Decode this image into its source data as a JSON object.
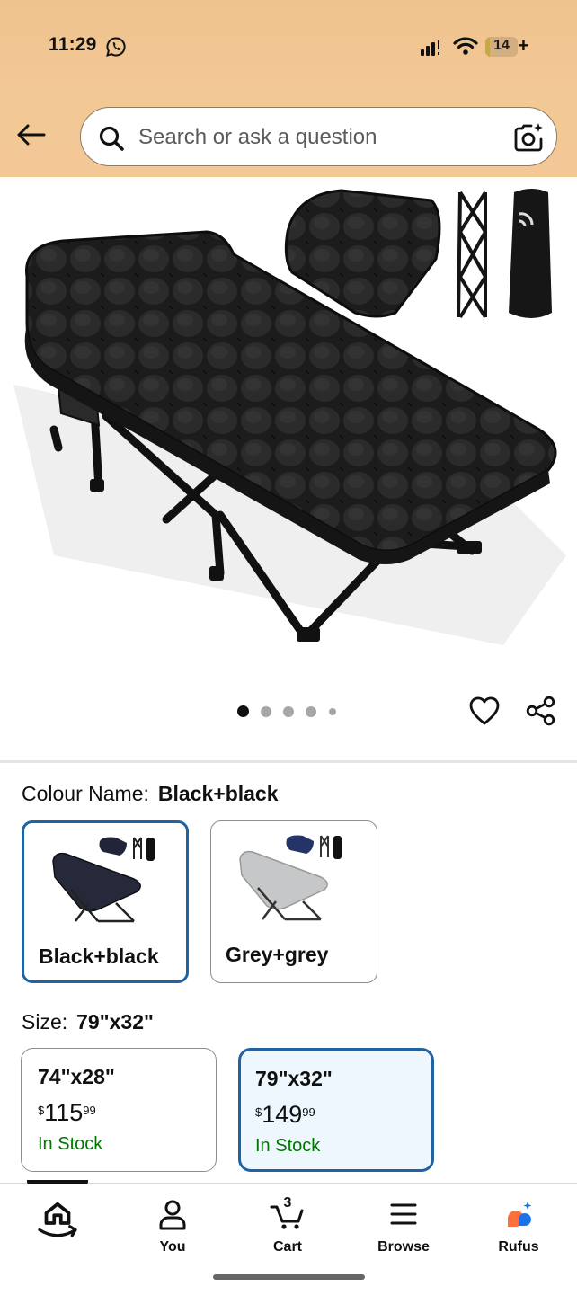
{
  "status_bar": {
    "time": "11:29",
    "battery_level": "14",
    "battery_charging": "+"
  },
  "search": {
    "placeholder": "Search or ask a question"
  },
  "gallery": {
    "image_count": 5,
    "active_index": 0
  },
  "colour": {
    "label": "Colour Name:",
    "selected": "Black+black",
    "options": [
      {
        "name": "Black+black",
        "selected": true
      },
      {
        "name": "Grey+grey",
        "selected": false
      }
    ]
  },
  "size": {
    "label": "Size:",
    "selected": "79\"x32\"",
    "options": [
      {
        "name": "74\"x28\"",
        "currency": "$",
        "price_whole": "115",
        "price_fraction": "99",
        "stock": "In Stock",
        "selected": false
      },
      {
        "name": "79\"x32\"",
        "currency": "$",
        "price_whole": "149",
        "price_fraction": "99",
        "stock": "In Stock",
        "selected": true
      }
    ]
  },
  "bottom_nav": {
    "items": [
      {
        "label": "",
        "icon": "home-icon",
        "active": true
      },
      {
        "label": "You",
        "icon": "user-icon"
      },
      {
        "label": "Cart",
        "icon": "cart-icon",
        "count": "3"
      },
      {
        "label": "Browse",
        "icon": "menu-icon"
      },
      {
        "label": "Rufus",
        "icon": "rufus-icon"
      }
    ]
  },
  "colors": {
    "header_bg": "#f2c795",
    "selected_border": "#2162a1",
    "selected_bg": "#edf7fd",
    "in_stock": "#007600",
    "rufus_orange": "#ff6f3c",
    "rufus_blue": "#1a73e8"
  }
}
